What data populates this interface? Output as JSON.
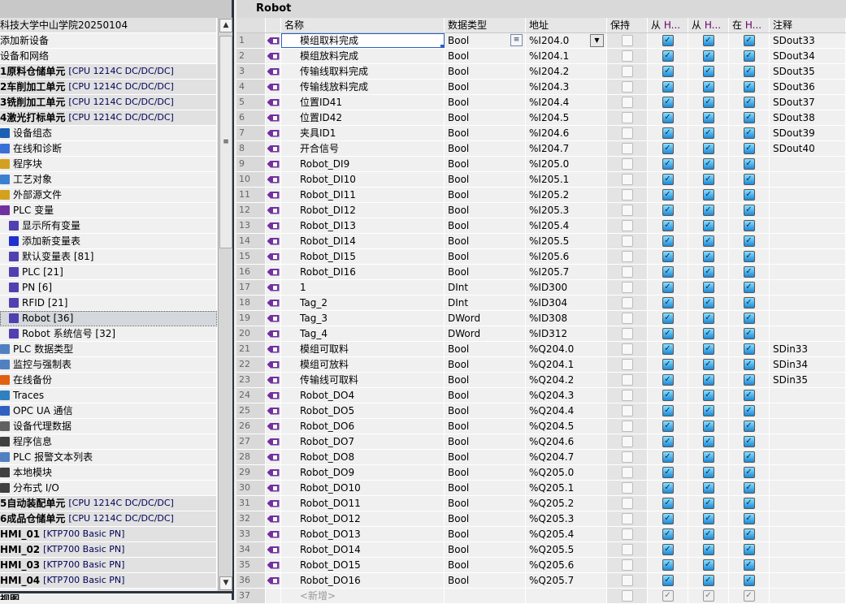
{
  "tree": [
    {
      "label": "科技大学中山学院20250104",
      "type": "root",
      "indent": -4
    },
    {
      "label": "添加新设备",
      "indent": -8
    },
    {
      "label": "设备和网络",
      "indent": -8
    },
    {
      "label": "1原料仓储单元",
      "cpu": "[CPU 1214C DC/DC/DC]",
      "type": "grp",
      "indent": 0
    },
    {
      "label": "2车削加工单元",
      "cpu": "[CPU 1214C DC/DC/DC]",
      "type": "grp",
      "indent": 0
    },
    {
      "label": "3铣削加工单元",
      "cpu": "[CPU 1214C DC/DC/DC]",
      "type": "grp",
      "indent": 0
    },
    {
      "label": "4激光打标单元",
      "cpu": "[CPU 1214C DC/DC/DC]",
      "type": "grp",
      "indent": 0
    },
    {
      "label": "设备组态",
      "icon": "#1a5fb4",
      "indent": -5
    },
    {
      "label": "在线和诊断",
      "icon": "#3a6fd8",
      "indent": -5
    },
    {
      "label": "程序块",
      "icon": "#d4a020",
      "indent": -5
    },
    {
      "label": "工艺对象",
      "icon": "#3a80d0",
      "indent": -5
    },
    {
      "label": "外部源文件",
      "icon": "#d4a020",
      "indent": -5
    },
    {
      "label": "PLC 变量",
      "icon": "#7030a0",
      "indent": -5
    },
    {
      "label": "显示所有变量",
      "icon": "#5040b0",
      "indent": 11
    },
    {
      "label": "添加新变量表",
      "icon": "#2030d0",
      "indent": 11
    },
    {
      "label": "默认变量表 [81]",
      "icon": "#5040b0",
      "indent": 11
    },
    {
      "label": "PLC [21]",
      "icon": "#5040b0",
      "indent": 11
    },
    {
      "label": "PN [6]",
      "icon": "#5040b0",
      "indent": 11
    },
    {
      "label": "RFID [21]",
      "icon": "#5040b0",
      "indent": 11
    },
    {
      "label": "Robot [36]",
      "icon": "#5040b0",
      "indent": 11,
      "selected": true
    },
    {
      "label": "Robot 系统信号 [32]",
      "icon": "#5040b0",
      "indent": 11
    },
    {
      "label": "PLC 数据类型",
      "icon": "#5080c0",
      "indent": -5
    },
    {
      "label": "监控与强制表",
      "icon": "#5080c0",
      "indent": -5
    },
    {
      "label": "在线备份",
      "icon": "#e06010",
      "indent": -5
    },
    {
      "label": "Traces",
      "icon": "#3080c0",
      "indent": -5
    },
    {
      "label": "OPC UA 通信",
      "icon": "#3060c0",
      "indent": -5
    },
    {
      "label": "设备代理数据",
      "icon": "#606060",
      "indent": -5
    },
    {
      "label": "程序信息",
      "icon": "#404040",
      "indent": -5
    },
    {
      "label": "PLC 报警文本列表",
      "icon": "#5080c0",
      "indent": -5
    },
    {
      "label": "本地模块",
      "icon": "#404040",
      "indent": -5
    },
    {
      "label": "分布式 I/O",
      "icon": "#404040",
      "indent": -5
    },
    {
      "label": "5自动装配单元",
      "cpu": "[CPU 1214C DC/DC/DC]",
      "type": "grp",
      "indent": 0
    },
    {
      "label": "6成品仓储单元",
      "cpu": "[CPU 1214C DC/DC/DC]",
      "type": "grp",
      "indent": 0
    },
    {
      "label": "HMI_01",
      "cpu": "[KTP700 Basic PN]",
      "type": "grp",
      "indent": -8
    },
    {
      "label": "HMI_02",
      "cpu": "[KTP700 Basic PN]",
      "type": "grp",
      "indent": -8
    },
    {
      "label": "HMI_03",
      "cpu": "[KTP700 Basic PN]",
      "type": "grp",
      "indent": -8
    },
    {
      "label": "HMI_04",
      "cpu": "[KTP700 Basic PN]",
      "type": "grp",
      "indent": -8
    }
  ],
  "left_bottom": "视图",
  "title": "Robot",
  "headers": {
    "name": "名称",
    "type": "数据类型",
    "addr": "地址",
    "retain": "保持",
    "h1a": "从 ",
    "h1b": "H...",
    "h2a": "从 ",
    "h2b": "H...",
    "h3a": "在 ",
    "h3b": "H...",
    "comment": "注释"
  },
  "rows": [
    [
      "1",
      "模组取料完成",
      "Bool",
      "%I204.0",
      "SDout33"
    ],
    [
      "2",
      "模组放料完成",
      "Bool",
      "%I204.1",
      "SDout34"
    ],
    [
      "3",
      "传输线取料完成",
      "Bool",
      "%I204.2",
      "SDout35"
    ],
    [
      "4",
      "传输线放料完成",
      "Bool",
      "%I204.3",
      "SDout36"
    ],
    [
      "5",
      "位置ID41",
      "Bool",
      "%I204.4",
      "SDout37"
    ],
    [
      "6",
      "位置ID42",
      "Bool",
      "%I204.5",
      "SDout38"
    ],
    [
      "7",
      "夹具ID1",
      "Bool",
      "%I204.6",
      "SDout39"
    ],
    [
      "8",
      "开合信号",
      "Bool",
      "%I204.7",
      "SDout40"
    ],
    [
      "9",
      "Robot_DI9",
      "Bool",
      "%I205.0",
      ""
    ],
    [
      "10",
      "Robot_DI10",
      "Bool",
      "%I205.1",
      ""
    ],
    [
      "11",
      "Robot_DI11",
      "Bool",
      "%I205.2",
      ""
    ],
    [
      "12",
      "Robot_DI12",
      "Bool",
      "%I205.3",
      ""
    ],
    [
      "13",
      "Robot_DI13",
      "Bool",
      "%I205.4",
      ""
    ],
    [
      "14",
      "Robot_DI14",
      "Bool",
      "%I205.5",
      ""
    ],
    [
      "15",
      "Robot_DI15",
      "Bool",
      "%I205.6",
      ""
    ],
    [
      "16",
      "Robot_DI16",
      "Bool",
      "%I205.7",
      ""
    ],
    [
      "17",
      "1",
      "DInt",
      "%ID300",
      ""
    ],
    [
      "18",
      "Tag_2",
      "DInt",
      "%ID304",
      ""
    ],
    [
      "19",
      "Tag_3",
      "DWord",
      "%ID308",
      ""
    ],
    [
      "20",
      "Tag_4",
      "DWord",
      "%ID312",
      ""
    ],
    [
      "21",
      "模组可取料",
      "Bool",
      "%Q204.0",
      "SDin33"
    ],
    [
      "22",
      "模组可放料",
      "Bool",
      "%Q204.1",
      "SDin34"
    ],
    [
      "23",
      "传输线可取料",
      "Bool",
      "%Q204.2",
      "SDin35"
    ],
    [
      "24",
      "Robot_DO4",
      "Bool",
      "%Q204.3",
      ""
    ],
    [
      "25",
      "Robot_DO5",
      "Bool",
      "%Q204.4",
      ""
    ],
    [
      "26",
      "Robot_DO6",
      "Bool",
      "%Q204.5",
      ""
    ],
    [
      "27",
      "Robot_DO7",
      "Bool",
      "%Q204.6",
      ""
    ],
    [
      "28",
      "Robot_DO8",
      "Bool",
      "%Q204.7",
      ""
    ],
    [
      "29",
      "Robot_DO9",
      "Bool",
      "%Q205.0",
      ""
    ],
    [
      "30",
      "Robot_DO10",
      "Bool",
      "%Q205.1",
      ""
    ],
    [
      "31",
      "Robot_DO11",
      "Bool",
      "%Q205.2",
      ""
    ],
    [
      "32",
      "Robot_DO12",
      "Bool",
      "%Q205.3",
      ""
    ],
    [
      "33",
      "Robot_DO13",
      "Bool",
      "%Q205.4",
      ""
    ],
    [
      "34",
      "Robot_DO14",
      "Bool",
      "%Q205.5",
      ""
    ],
    [
      "35",
      "Robot_DO15",
      "Bool",
      "%Q205.6",
      ""
    ],
    [
      "36",
      "Robot_DO16",
      "Bool",
      "%Q205.7",
      ""
    ]
  ],
  "new_row": {
    "num": "37",
    "label": "<新增>"
  }
}
